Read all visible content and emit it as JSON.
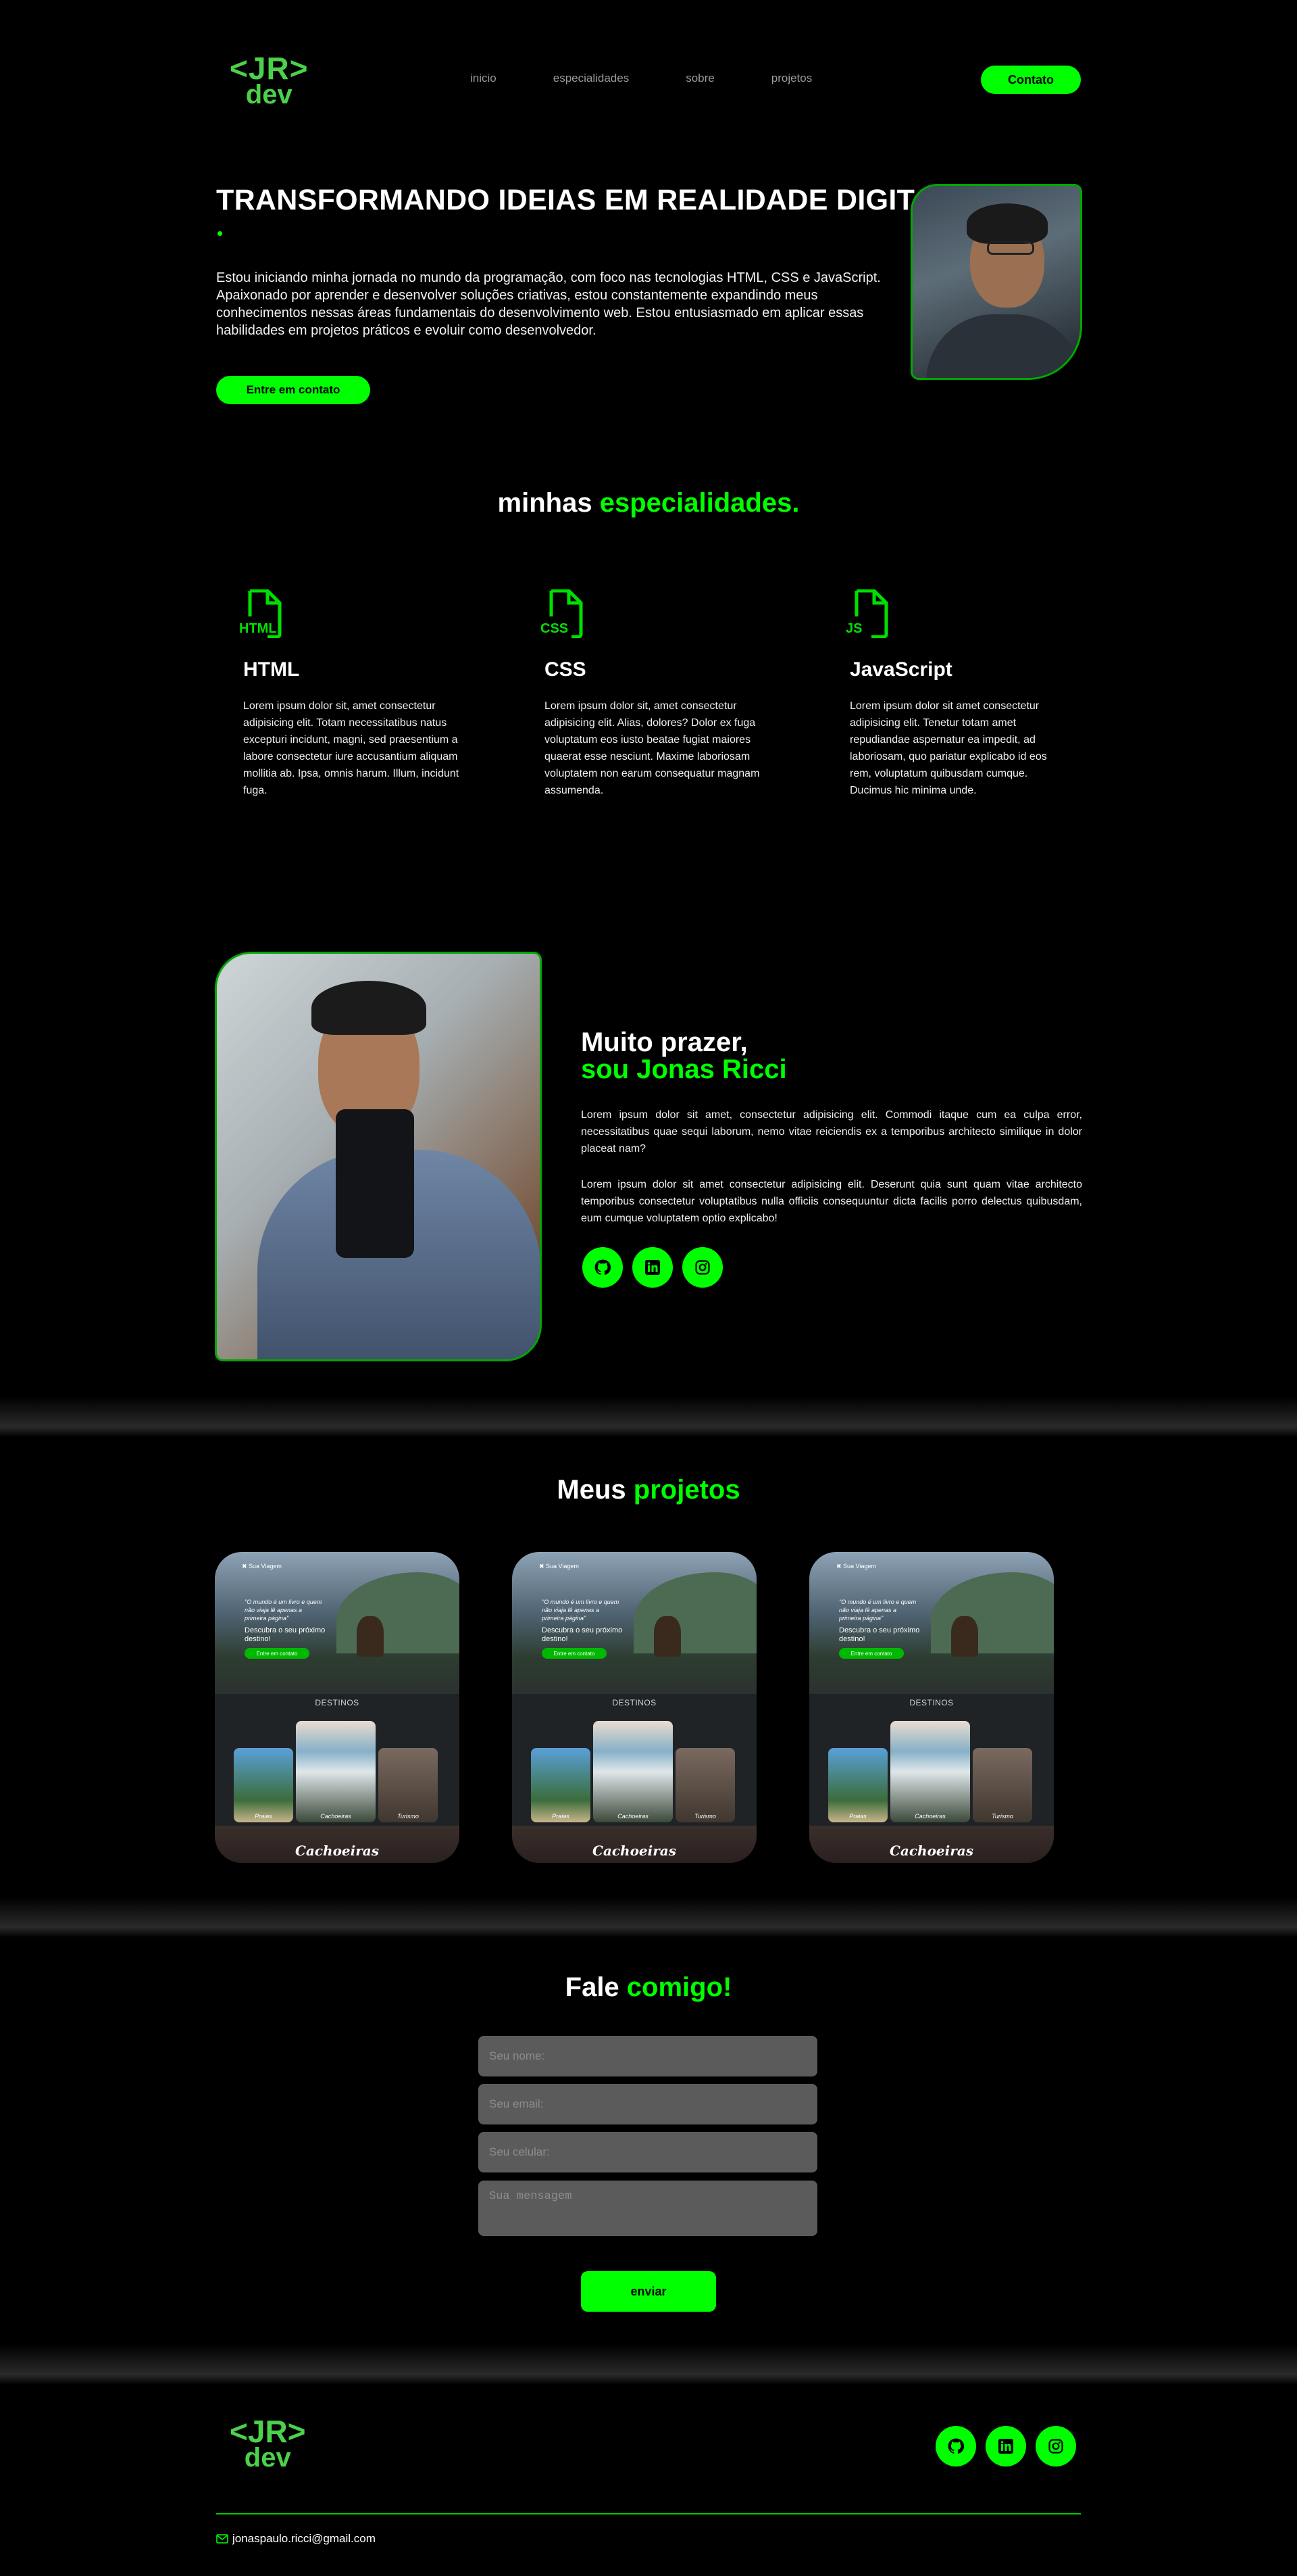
{
  "logo": {
    "top": "<JR>",
    "bottom": "dev"
  },
  "nav": {
    "items": [
      "inicio",
      "especialidades",
      "sobre",
      "projetos"
    ],
    "contact_button": "Contato"
  },
  "hero": {
    "title": "TRANSFORMANDO IDEIAS EM REALIDADE DIGITAL",
    "text": "Estou iniciando minha jornada no mundo da programação, com foco nas tecnologias HTML, CSS e JavaScript. Apaixonado por aprender e desenvolver soluções criativas, estou constantemente expandindo meus conhecimentos nessas áreas fundamentais do desenvolvimento web. Estou entusiasmado em aplicar essas habilidades em projetos práticos e evoluir como desenvolvedor.",
    "button": "Entre em contato"
  },
  "specialties": {
    "title_white": "minhas ",
    "title_green": "especialidades.",
    "items": [
      {
        "icon_label": "HTML",
        "title": "HTML",
        "text": "Lorem ipsum dolor sit, amet consectetur adipisicing elit. Totam necessitatibus natus excepturi incidunt, magni, sed praesentium a labore consectetur iure accusantium aliquam mollitia ab. Ipsa, omnis harum. Illum, incidunt fuga."
      },
      {
        "icon_label": "CSS",
        "title": "CSS",
        "text": "Lorem ipsum dolor sit, amet consectetur adipisicing elit. Alias, dolores? Dolor ex fuga voluptatum eos iusto beatae fugiat maiores quaerat esse nesciunt. Maxime laboriosam voluptatem non earum consequatur magnam assumenda."
      },
      {
        "icon_label": "JS",
        "title": "JavaScript",
        "text": "Lorem ipsum dolor sit amet consectetur adipisicing elit. Tenetur totam amet repudiandae aspernatur ea impedit, ad laboriosam, quo pariatur explicabo id eos rem, voluptatum quibusdam cumque. Ducimus hic minima unde."
      }
    ]
  },
  "about": {
    "title_line1": "Muito prazer,",
    "title_line2": "sou Jonas Ricci",
    "p1": "Lorem ipsum dolor sit amet, consectetur adipisicing elit. Commodi itaque cum ea culpa error, necessitatibus quae sequi laborum, nemo vitae reiciendis ex a temporibus architecto similique in dolor placeat nam?",
    "p2": "Lorem ipsum dolor sit amet consectetur adipisicing elit. Deserunt quia sunt quam vitae architecto temporibus consectetur voluptatibus nulla officiis consequuntur dicta facilis porro delectus quibusdam, eum cumque voluptatem optio explicabo!",
    "social_icons": [
      "github-icon",
      "linkedin-icon",
      "instagram-icon"
    ]
  },
  "projects": {
    "title_white": "Meus ",
    "title_green": "projetos",
    "items": [
      {
        "brand": "Sua Viagem",
        "quote": "\"O mundo é um livro e quem não viaja lê apenas a primeira página\"",
        "desc": "Descubra o seu próximo destino!",
        "button": "Entre em contato",
        "section": "DESTINOS",
        "cards": [
          "Praias",
          "Cachoeiras",
          "Turismo"
        ],
        "footer": "Cachoeiras"
      },
      {
        "brand": "Sua Viagem",
        "quote": "\"O mundo é um livro e quem não viaja lê apenas a primeira página\"",
        "desc": "Descubra o seu próximo destino!",
        "button": "Entre em contato",
        "section": "DESTINOS",
        "cards": [
          "Praias",
          "Cachoeiras",
          "Turismo"
        ],
        "footer": "Cachoeiras"
      },
      {
        "brand": "Sua Viagem",
        "quote": "\"O mundo é um livro e quem não viaja lê apenas a primeira página\"",
        "desc": "Descubra o seu próximo destino!",
        "button": "Entre em contato",
        "section": "DESTINOS",
        "cards": [
          "Praias",
          "Cachoeiras",
          "Turismo"
        ],
        "footer": "Cachoeiras"
      }
    ]
  },
  "contact": {
    "title_white": "Fale ",
    "title_green": "comigo!",
    "name_placeholder": "Seu nome:",
    "email_placeholder": "Seu email:",
    "phone_placeholder": "Seu celular:",
    "message_placeholder": "Sua mensagem",
    "submit": "enviar"
  },
  "footer": {
    "email": "jonaspaulo.ricci@gmail.com"
  },
  "colors": {
    "accent": "#00ff00",
    "background": "#000000",
    "field": "#5b5b5b"
  }
}
